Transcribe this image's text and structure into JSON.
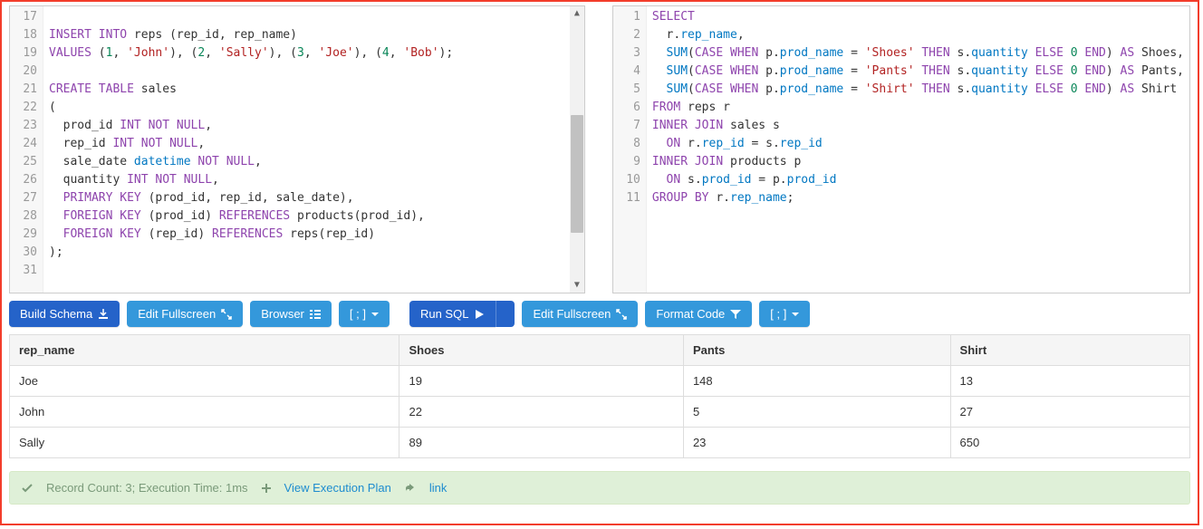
{
  "leftEditor": {
    "startLine": 17,
    "lines": [
      {
        "n": 17,
        "tokens": []
      },
      {
        "n": 18,
        "tokens": [
          [
            "kw",
            "INSERT"
          ],
          [
            "plain",
            " "
          ],
          [
            "kw",
            "INTO"
          ],
          [
            "plain",
            " reps (rep_id, rep_name)"
          ]
        ]
      },
      {
        "n": 19,
        "tokens": [
          [
            "kw",
            "VALUES"
          ],
          [
            "plain",
            " ("
          ],
          [
            "num",
            "1"
          ],
          [
            "plain",
            ", "
          ],
          [
            "str",
            "'John'"
          ],
          [
            "plain",
            "), ("
          ],
          [
            "num",
            "2"
          ],
          [
            "plain",
            ", "
          ],
          [
            "str",
            "'Sally'"
          ],
          [
            "plain",
            "), ("
          ],
          [
            "num",
            "3"
          ],
          [
            "plain",
            ", "
          ],
          [
            "str",
            "'Joe'"
          ],
          [
            "plain",
            "), ("
          ],
          [
            "num",
            "4"
          ],
          [
            "plain",
            ", "
          ],
          [
            "str",
            "'Bob'"
          ],
          [
            "plain",
            ");"
          ]
        ]
      },
      {
        "n": 20,
        "tokens": []
      },
      {
        "n": 21,
        "tokens": [
          [
            "kw",
            "CREATE"
          ],
          [
            "plain",
            " "
          ],
          [
            "kw",
            "TABLE"
          ],
          [
            "plain",
            " sales"
          ]
        ]
      },
      {
        "n": 22,
        "tokens": [
          [
            "plain",
            "("
          ]
        ]
      },
      {
        "n": 23,
        "tokens": [
          [
            "plain",
            "  prod_id "
          ],
          [
            "kw",
            "INT"
          ],
          [
            "plain",
            " "
          ],
          [
            "kw",
            "NOT"
          ],
          [
            "plain",
            " "
          ],
          [
            "kw",
            "NULL"
          ],
          [
            "plain",
            ","
          ]
        ]
      },
      {
        "n": 24,
        "tokens": [
          [
            "plain",
            "  rep_id "
          ],
          [
            "kw",
            "INT"
          ],
          [
            "plain",
            " "
          ],
          [
            "kw",
            "NOT"
          ],
          [
            "plain",
            " "
          ],
          [
            "kw",
            "NULL"
          ],
          [
            "plain",
            ","
          ]
        ]
      },
      {
        "n": 25,
        "tokens": [
          [
            "plain",
            "  sale_date "
          ],
          [
            "id",
            "datetime"
          ],
          [
            "plain",
            " "
          ],
          [
            "kw",
            "NOT"
          ],
          [
            "plain",
            " "
          ],
          [
            "kw",
            "NULL"
          ],
          [
            "plain",
            ","
          ]
        ]
      },
      {
        "n": 26,
        "tokens": [
          [
            "plain",
            "  quantity "
          ],
          [
            "kw",
            "INT"
          ],
          [
            "plain",
            " "
          ],
          [
            "kw",
            "NOT"
          ],
          [
            "plain",
            " "
          ],
          [
            "kw",
            "NULL"
          ],
          [
            "plain",
            ","
          ]
        ]
      },
      {
        "n": 27,
        "tokens": [
          [
            "plain",
            "  "
          ],
          [
            "kw",
            "PRIMARY"
          ],
          [
            "plain",
            " "
          ],
          [
            "kw",
            "KEY"
          ],
          [
            "plain",
            " (prod_id, rep_id, sale_date),"
          ]
        ]
      },
      {
        "n": 28,
        "tokens": [
          [
            "plain",
            "  "
          ],
          [
            "kw",
            "FOREIGN"
          ],
          [
            "plain",
            " "
          ],
          [
            "kw",
            "KEY"
          ],
          [
            "plain",
            " (prod_id) "
          ],
          [
            "kw",
            "REFERENCES"
          ],
          [
            "plain",
            " products(prod_id),"
          ]
        ]
      },
      {
        "n": 29,
        "tokens": [
          [
            "plain",
            "  "
          ],
          [
            "kw",
            "FOREIGN"
          ],
          [
            "plain",
            " "
          ],
          [
            "kw",
            "KEY"
          ],
          [
            "plain",
            " (rep_id) "
          ],
          [
            "kw",
            "REFERENCES"
          ],
          [
            "plain",
            " reps(rep_id)"
          ]
        ]
      },
      {
        "n": 30,
        "tokens": [
          [
            "plain",
            ");"
          ]
        ]
      },
      {
        "n": 31,
        "tokens": []
      }
    ]
  },
  "rightEditor": {
    "startLine": 1,
    "lines": [
      {
        "n": 1,
        "tokens": [
          [
            "kw",
            "SELECT"
          ]
        ]
      },
      {
        "n": 2,
        "tokens": [
          [
            "plain",
            "  r."
          ],
          [
            "id",
            "rep_name"
          ],
          [
            "plain",
            ","
          ]
        ]
      },
      {
        "n": 3,
        "tokens": [
          [
            "plain",
            "  "
          ],
          [
            "fn",
            "SUM"
          ],
          [
            "plain",
            "("
          ],
          [
            "kw",
            "CASE"
          ],
          [
            "plain",
            " "
          ],
          [
            "kw",
            "WHEN"
          ],
          [
            "plain",
            " p."
          ],
          [
            "id",
            "prod_name"
          ],
          [
            "plain",
            " = "
          ],
          [
            "str",
            "'Shoes'"
          ],
          [
            "plain",
            " "
          ],
          [
            "kw",
            "THEN"
          ],
          [
            "plain",
            " s."
          ],
          [
            "id",
            "quantity"
          ],
          [
            "plain",
            " "
          ],
          [
            "kw",
            "ELSE"
          ],
          [
            "plain",
            " "
          ],
          [
            "num",
            "0"
          ],
          [
            "plain",
            " "
          ],
          [
            "kw",
            "END"
          ],
          [
            "plain",
            ") "
          ],
          [
            "kw",
            "AS"
          ],
          [
            "plain",
            " Shoes,"
          ]
        ]
      },
      {
        "n": 4,
        "tokens": [
          [
            "plain",
            "  "
          ],
          [
            "fn",
            "SUM"
          ],
          [
            "plain",
            "("
          ],
          [
            "kw",
            "CASE"
          ],
          [
            "plain",
            " "
          ],
          [
            "kw",
            "WHEN"
          ],
          [
            "plain",
            " p."
          ],
          [
            "id",
            "prod_name"
          ],
          [
            "plain",
            " = "
          ],
          [
            "str",
            "'Pants'"
          ],
          [
            "plain",
            " "
          ],
          [
            "kw",
            "THEN"
          ],
          [
            "plain",
            " s."
          ],
          [
            "id",
            "quantity"
          ],
          [
            "plain",
            " "
          ],
          [
            "kw",
            "ELSE"
          ],
          [
            "plain",
            " "
          ],
          [
            "num",
            "0"
          ],
          [
            "plain",
            " "
          ],
          [
            "kw",
            "END"
          ],
          [
            "plain",
            ") "
          ],
          [
            "kw",
            "AS"
          ],
          [
            "plain",
            " Pants,"
          ]
        ]
      },
      {
        "n": 5,
        "tokens": [
          [
            "plain",
            "  "
          ],
          [
            "fn",
            "SUM"
          ],
          [
            "plain",
            "("
          ],
          [
            "kw",
            "CASE"
          ],
          [
            "plain",
            " "
          ],
          [
            "kw",
            "WHEN"
          ],
          [
            "plain",
            " p."
          ],
          [
            "id",
            "prod_name"
          ],
          [
            "plain",
            " = "
          ],
          [
            "str",
            "'Shirt'"
          ],
          [
            "plain",
            " "
          ],
          [
            "kw",
            "THEN"
          ],
          [
            "plain",
            " s."
          ],
          [
            "id",
            "quantity"
          ],
          [
            "plain",
            " "
          ],
          [
            "kw",
            "ELSE"
          ],
          [
            "plain",
            " "
          ],
          [
            "num",
            "0"
          ],
          [
            "plain",
            " "
          ],
          [
            "kw",
            "END"
          ],
          [
            "plain",
            ") "
          ],
          [
            "kw",
            "AS"
          ],
          [
            "plain",
            " Shirt"
          ]
        ]
      },
      {
        "n": 6,
        "tokens": [
          [
            "kw",
            "FROM"
          ],
          [
            "plain",
            " reps r"
          ]
        ]
      },
      {
        "n": 7,
        "tokens": [
          [
            "kw",
            "INNER"
          ],
          [
            "plain",
            " "
          ],
          [
            "kw",
            "JOIN"
          ],
          [
            "plain",
            " sales s"
          ]
        ]
      },
      {
        "n": 8,
        "tokens": [
          [
            "plain",
            "  "
          ],
          [
            "kw",
            "ON"
          ],
          [
            "plain",
            " r."
          ],
          [
            "id",
            "rep_id"
          ],
          [
            "plain",
            " = s."
          ],
          [
            "id",
            "rep_id"
          ]
        ]
      },
      {
        "n": 9,
        "tokens": [
          [
            "kw",
            "INNER"
          ],
          [
            "plain",
            " "
          ],
          [
            "kw",
            "JOIN"
          ],
          [
            "plain",
            " products p"
          ]
        ]
      },
      {
        "n": 10,
        "tokens": [
          [
            "plain",
            "  "
          ],
          [
            "kw",
            "ON"
          ],
          [
            "plain",
            " s."
          ],
          [
            "id",
            "prod_id"
          ],
          [
            "plain",
            " = p."
          ],
          [
            "id",
            "prod_id"
          ]
        ]
      },
      {
        "n": 11,
        "tokens": [
          [
            "kw",
            "GROUP"
          ],
          [
            "plain",
            " "
          ],
          [
            "kw",
            "BY"
          ],
          [
            "plain",
            " r."
          ],
          [
            "id",
            "rep_name"
          ],
          [
            "plain",
            ";"
          ]
        ]
      }
    ]
  },
  "leftToolbar": {
    "build_schema": "Build Schema",
    "edit_fullscreen": "Edit Fullscreen",
    "browser": "Browser",
    "terminator": "[ ; ]"
  },
  "rightToolbar": {
    "run_sql": "Run SQL",
    "edit_fullscreen": "Edit Fullscreen",
    "format_code": "Format Code",
    "terminator": "[ ; ]"
  },
  "results": {
    "headers": [
      "rep_name",
      "Shoes",
      "Pants",
      "Shirt"
    ],
    "rows": [
      [
        "Joe",
        "19",
        "148",
        "13"
      ],
      [
        "John",
        "22",
        "5",
        "27"
      ],
      [
        "Sally",
        "89",
        "23",
        "650"
      ]
    ]
  },
  "status": {
    "text": "Record Count: 3; Execution Time: 1ms",
    "plan_link": "View Execution Plan",
    "link": "link"
  }
}
